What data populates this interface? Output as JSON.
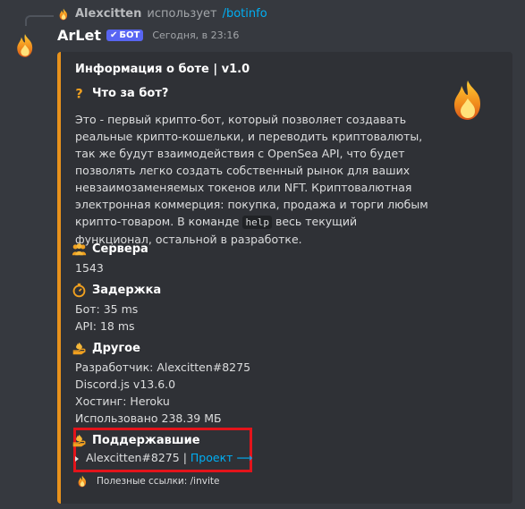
{
  "reply": {
    "user": "Alexcitten",
    "action": "использует",
    "command": "/botinfo"
  },
  "message": {
    "author": "ArLet",
    "bot_tag": "БОТ",
    "timestamp": "Сегодня, в 23:16"
  },
  "embed": {
    "accent_color": "#e8921c",
    "title": "Информация о боте | v1.0",
    "about_title": "Что за бот?",
    "about_text_before": "Это - первый крипто-бот, который позволяет создавать реальные крипто-кошельки, и переводить криптовалюты, так же будут взаимодействия с OpenSea API, что будет позволять легко создать собственный рынок для ваших невзаимозаменяемых токенов или NFT. Криптовалютная электронная коммерция: покупка, продажа и торги любым крипто-товаром. В команде",
    "about_code": "help",
    "about_text_after": "весь текущий функционал, остальной в разработке.",
    "servers_title": "Сервера",
    "servers_value": "1543",
    "latency_title": "Задержка",
    "latency_bot": "Бот: 35 ms",
    "latency_api": "API: 18 ms",
    "other_title": "Другое",
    "other_dev": "Разработчик: Alexcitten#8275",
    "other_lib": "Discord.js v13.6.0",
    "other_host": "Хостинг: Heroku",
    "other_mem": "Использовано 238.39 МБ",
    "supporters_title": "Поддержавшие",
    "supporter_name": "Alexcitten#8275 |",
    "supporter_link": "Проект ⟶",
    "footer_text": "Полезные ссылки: /invite"
  },
  "icons": {
    "about": "question-icon",
    "servers": "group-icon",
    "latency": "stopwatch-icon",
    "other": "flame-hand-icon",
    "supporters": "flame-hand-icon"
  }
}
